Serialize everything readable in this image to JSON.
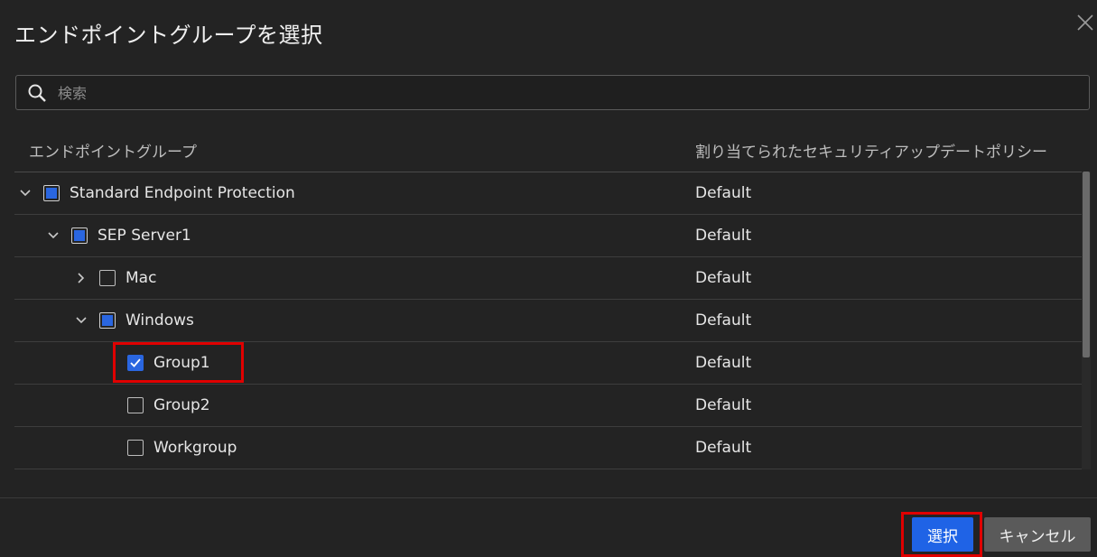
{
  "dialog": {
    "title": "エンドポイントグループを選択",
    "close_icon": "close-icon"
  },
  "search": {
    "placeholder": "検索",
    "value": "",
    "icon": "search-icon"
  },
  "table": {
    "columns": [
      "エンドポイントグループ",
      "割り当てられたセキュリティアップデートポリシー"
    ],
    "rows": [
      {
        "name": "Standard Endpoint Protection",
        "policy": "Default",
        "level": 0,
        "expander": "expanded",
        "check": "partial"
      },
      {
        "name": "SEP Server1",
        "policy": "Default",
        "level": 1,
        "expander": "expanded",
        "check": "partial"
      },
      {
        "name": "Mac",
        "policy": "Default",
        "level": 2,
        "expander": "collapsed",
        "check": "unchecked"
      },
      {
        "name": "Windows",
        "policy": "Default",
        "level": 2,
        "expander": "expanded",
        "check": "partial"
      },
      {
        "name": "Group1",
        "policy": "Default",
        "level": 3,
        "expander": "none",
        "check": "checked"
      },
      {
        "name": "Group2",
        "policy": "Default",
        "level": 3,
        "expander": "none",
        "check": "unchecked"
      },
      {
        "name": "Workgroup",
        "policy": "Default",
        "level": 3,
        "expander": "none",
        "check": "unchecked"
      }
    ]
  },
  "buttons": {
    "select": "選択",
    "cancel": "キャンセル"
  },
  "colors": {
    "background": "#232323",
    "accent": "#1f63e6",
    "highlight": "#e00000"
  }
}
